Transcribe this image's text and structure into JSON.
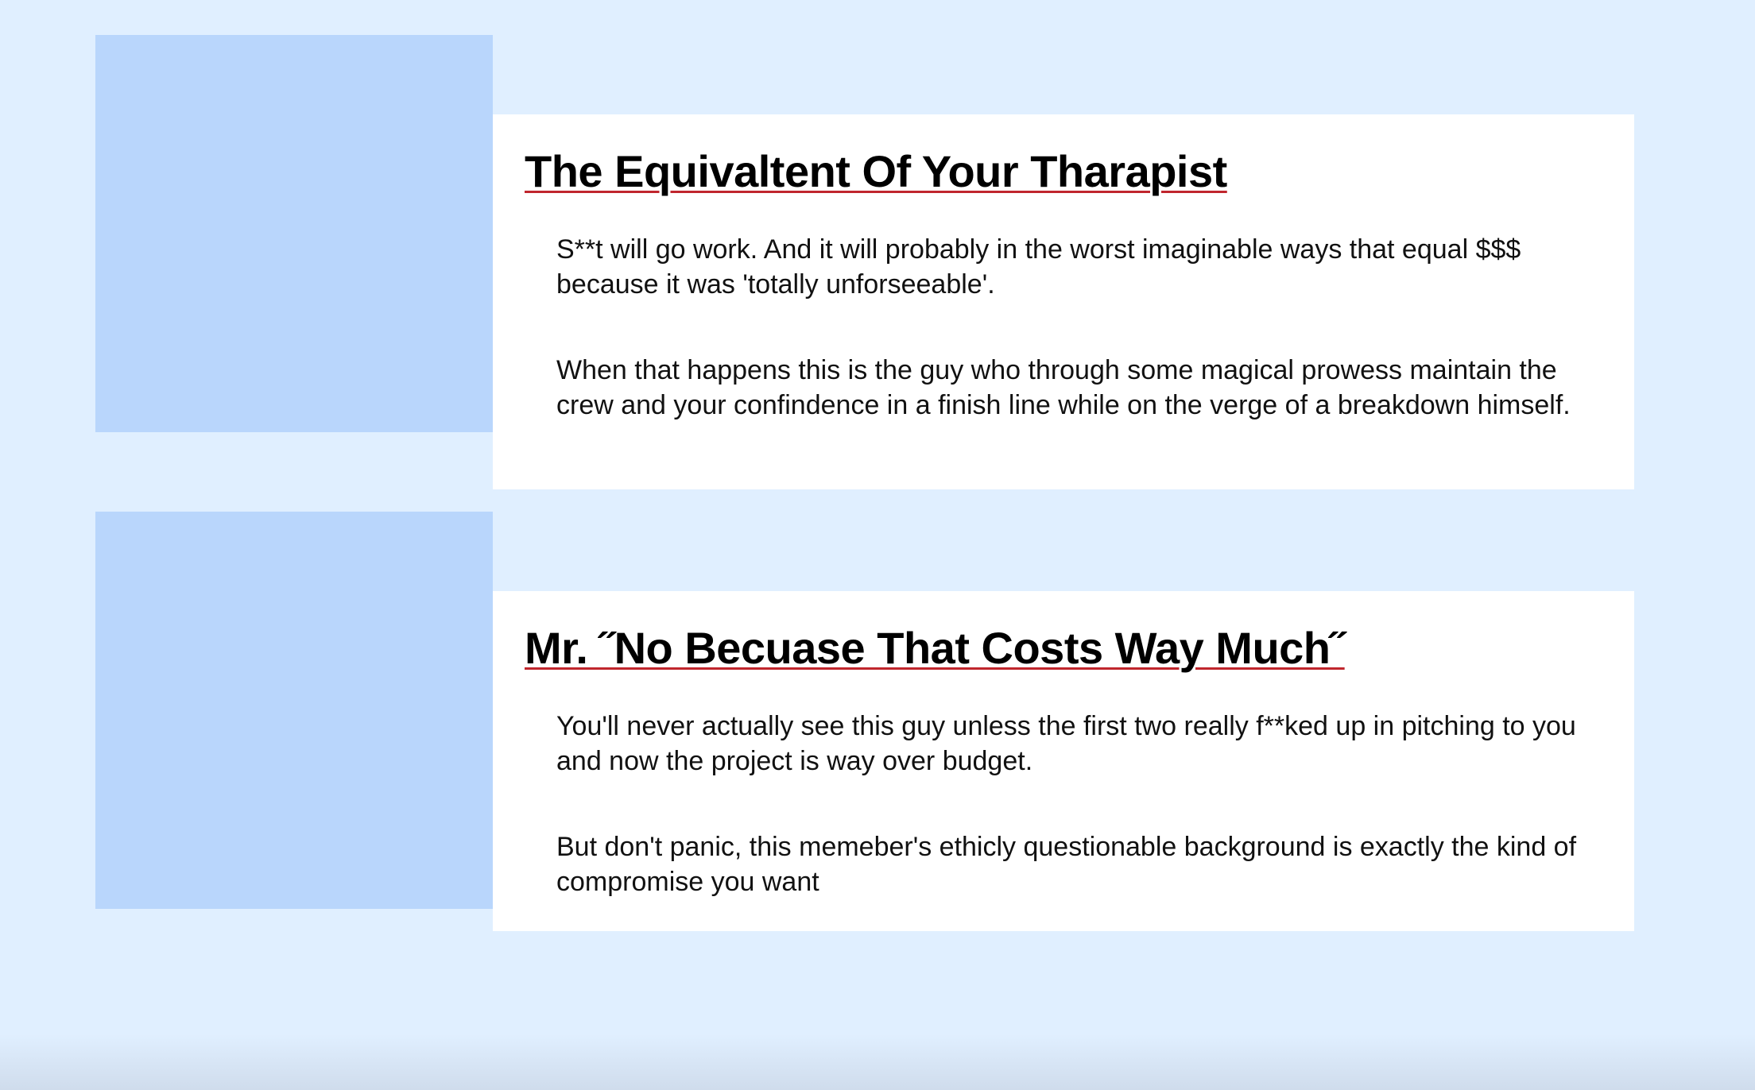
{
  "cards": [
    {
      "title": "The Equivaltent Of Your Tharapist",
      "paragraphs": [
        "S**t will go work. And it will probably in the worst imaginable ways that equal $$$ because it was 'totally unforseeable'.",
        "When that happens this is the guy who through some magical prowess maintain the crew and your confindence in a finish line while on the verge of a breakdown himself."
      ]
    },
    {
      "title": "Mr. ˝No Becuase That Costs Way Much˝",
      "paragraphs": [
        "You'll never actually see this guy unless the first two really f**ked up in pitching to you and now the project is way over budget.",
        "But don't panic, this memeber's ethicly questionable background is exactly the kind of compromise you want"
      ]
    }
  ],
  "colors": {
    "page_background": "#e0efff",
    "image_placeholder": "#b9d6fc",
    "panel_background": "#ffffff",
    "title_underline": "#c0262d"
  }
}
